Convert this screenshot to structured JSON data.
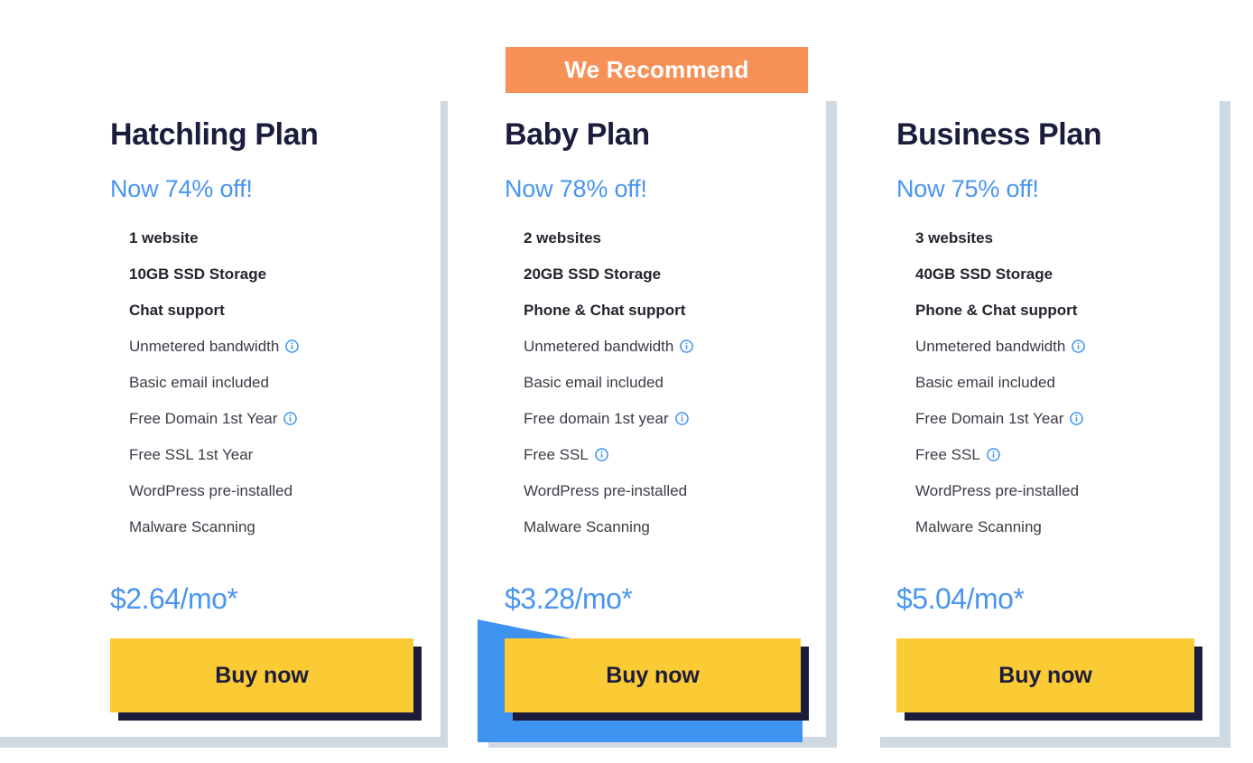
{
  "recommend_banner": {
    "label": "We Recommend"
  },
  "colors": {
    "heading": "#1C1C3C",
    "accent_blue": "#4A95EF",
    "banner_orange": "#F89157",
    "button_yellow": "#FBCB35",
    "button_shadow": "#1C1C3C",
    "card_shadow": "#CED9E3",
    "ribbon_blue": "#3E92F0"
  },
  "plans": [
    {
      "name": "Hatchling Plan",
      "discount": "Now 74% off!",
      "price": "$2.64/mo*",
      "buy_label": "Buy now",
      "recommended": false,
      "features": [
        {
          "label": "1 website",
          "bold": true,
          "info": false
        },
        {
          "label": "10GB SSD Storage",
          "bold": true,
          "info": false
        },
        {
          "label": "Chat support",
          "bold": true,
          "info": false
        },
        {
          "label": "Unmetered bandwidth",
          "bold": false,
          "info": true
        },
        {
          "label": "Basic email included",
          "bold": false,
          "info": false
        },
        {
          "label": "Free Domain 1st Year",
          "bold": false,
          "info": true
        },
        {
          "label": "Free SSL 1st Year",
          "bold": false,
          "info": false
        },
        {
          "label": "WordPress pre-installed",
          "bold": false,
          "info": false
        },
        {
          "label": "Malware Scanning",
          "bold": false,
          "info": false
        }
      ]
    },
    {
      "name": "Baby Plan",
      "discount": "Now 78% off!",
      "price": "$3.28/mo*",
      "buy_label": "Buy now",
      "recommended": true,
      "features": [
        {
          "label": "2 websites",
          "bold": true,
          "info": false
        },
        {
          "label": "20GB SSD Storage",
          "bold": true,
          "info": false
        },
        {
          "label": "Phone & Chat support",
          "bold": true,
          "info": false
        },
        {
          "label": "Unmetered bandwidth",
          "bold": false,
          "info": true
        },
        {
          "label": "Basic email included",
          "bold": false,
          "info": false
        },
        {
          "label": "Free domain 1st year",
          "bold": false,
          "info": true
        },
        {
          "label": "Free SSL",
          "bold": false,
          "info": true
        },
        {
          "label": "WordPress pre-installed",
          "bold": false,
          "info": false
        },
        {
          "label": "Malware Scanning",
          "bold": false,
          "info": false
        }
      ]
    },
    {
      "name": "Business Plan",
      "discount": "Now 75% off!",
      "price": "$5.04/mo*",
      "buy_label": "Buy now",
      "recommended": false,
      "features": [
        {
          "label": "3 websites",
          "bold": true,
          "info": false
        },
        {
          "label": "40GB SSD Storage",
          "bold": true,
          "info": false
        },
        {
          "label": "Phone & Chat support",
          "bold": true,
          "info": false
        },
        {
          "label": "Unmetered bandwidth",
          "bold": false,
          "info": true
        },
        {
          "label": "Basic email included",
          "bold": false,
          "info": false
        },
        {
          "label": "Free Domain 1st Year",
          "bold": false,
          "info": true
        },
        {
          "label": "Free SSL",
          "bold": false,
          "info": true
        },
        {
          "label": "WordPress pre-installed",
          "bold": false,
          "info": false
        },
        {
          "label": "Malware Scanning",
          "bold": false,
          "info": false
        }
      ]
    }
  ]
}
